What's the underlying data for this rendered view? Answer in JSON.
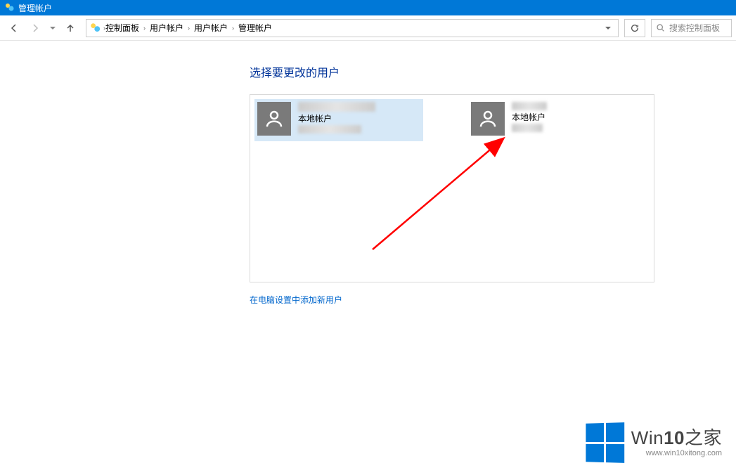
{
  "window": {
    "title": "管理帐户"
  },
  "nav": {
    "back_enabled": true,
    "forward_enabled": false
  },
  "breadcrumb": {
    "items": [
      "控制面板",
      "用户帐户",
      "用户帐户",
      "管理帐户"
    ]
  },
  "search": {
    "placeholder": "搜索控制面板"
  },
  "page": {
    "heading": "选择要更改的用户",
    "footer_link": "在电脑设置中添加新用户"
  },
  "accounts": [
    {
      "name": "████████",
      "type": "本地帐户",
      "extra": "████████",
      "selected": true
    },
    {
      "name": "████",
      "type": "本地帐户",
      "extra": "████",
      "selected": false
    }
  ],
  "watermark": {
    "brand_prefix": "Win",
    "brand_bold": "10",
    "brand_suffix": "之家",
    "url": "www.win10xitong.com"
  }
}
